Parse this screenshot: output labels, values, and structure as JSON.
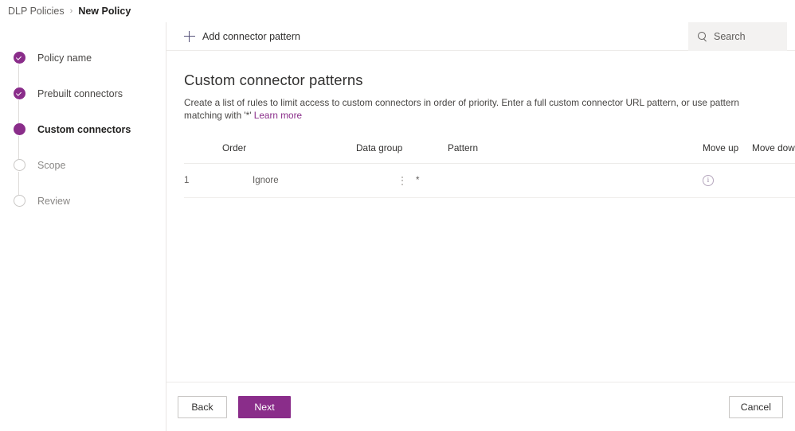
{
  "breadcrumb": {
    "parent": "DLP Policies",
    "separator": "›",
    "current": "New Policy"
  },
  "sidebar": {
    "steps": [
      {
        "label": "Policy name",
        "state": "done"
      },
      {
        "label": "Prebuilt connectors",
        "state": "done"
      },
      {
        "label": "Custom connectors",
        "state": "current"
      },
      {
        "label": "Scope",
        "state": "todo"
      },
      {
        "label": "Review",
        "state": "todo"
      }
    ]
  },
  "command_bar": {
    "add_button_label": "Add connector pattern",
    "add_button_icon": "plus-icon",
    "search": {
      "placeholder": "Search",
      "value": "",
      "icon": "search-icon"
    }
  },
  "main": {
    "title": "Custom connector patterns",
    "description_part1": "Create a list of rules to limit access to custom connectors in order of priority. Enter a full custom connector URL pattern, or use pattern matching with '*'",
    "learn_more_label": "Learn more"
  },
  "table": {
    "headers": {
      "order": "Order",
      "data_group": "Data group",
      "pattern": "Pattern",
      "move_up": "Move up",
      "move_down": "Move down"
    },
    "rows": [
      {
        "order": "1",
        "data_group": "Ignore",
        "data_group_menu_icon": "vertical-ellipsis-icon",
        "pattern": "*",
        "move_up_icon": "info-icon",
        "move_up_glyph": "i",
        "move_down": ""
      }
    ]
  },
  "footer": {
    "back_label": "Back",
    "next_label": "Next",
    "cancel_label": "Cancel"
  },
  "colors": {
    "accent": "#8a2d8a",
    "link": "#8a2d8a",
    "search_bg": "#f3f2f1",
    "border": "#edebe9",
    "text": "#323130",
    "muted_text": "#605e5c"
  }
}
